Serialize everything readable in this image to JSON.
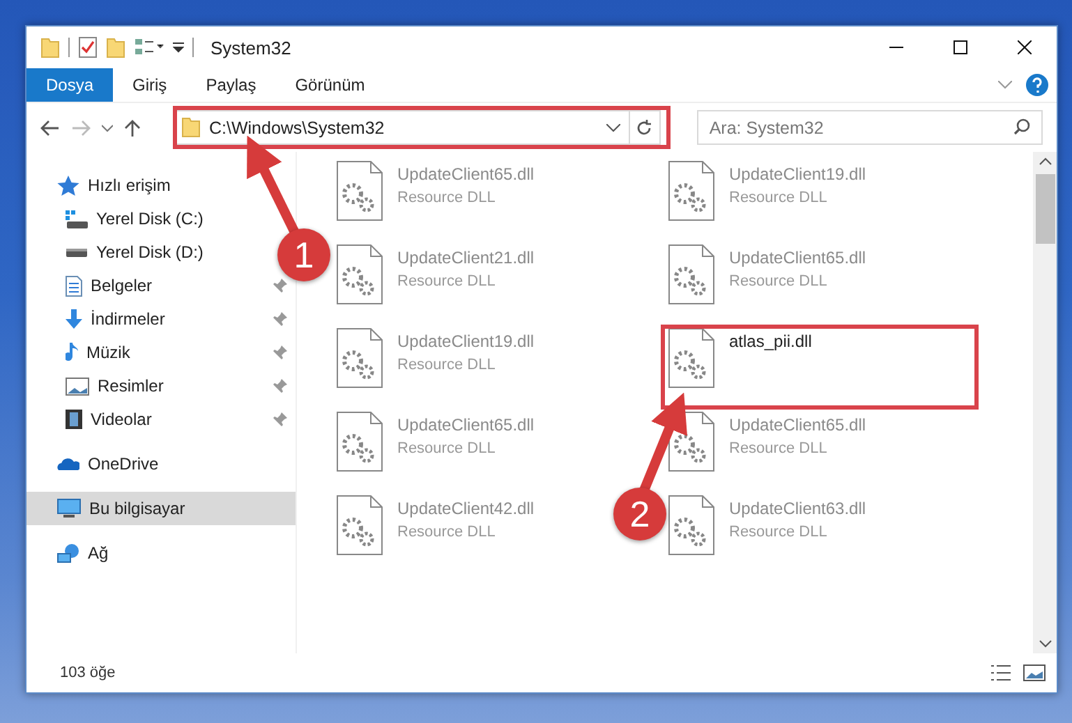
{
  "window": {
    "title": "System32"
  },
  "ribbon_tabs": [
    {
      "label": "Dosya",
      "selected": true
    },
    {
      "label": "Giriş",
      "selected": false
    },
    {
      "label": "Paylaş",
      "selected": false
    },
    {
      "label": "Görünüm",
      "selected": false
    }
  ],
  "address": {
    "path": "C:\\Windows\\System32"
  },
  "search": {
    "placeholder": "Ara: System32"
  },
  "sidebar": [
    {
      "label": "Hızlı erişim",
      "kind": "star",
      "selected": false,
      "children": [
        {
          "label": "Yerel Disk (C:)",
          "kind": "system-disk",
          "pinned": false
        },
        {
          "label": "Yerel Disk (D:)",
          "kind": "disk",
          "pinned": false
        },
        {
          "label": "Belgeler",
          "kind": "documents",
          "pinned": true
        },
        {
          "label": "İndirmeler",
          "kind": "download",
          "pinned": true
        },
        {
          "label": "Müzik",
          "kind": "music",
          "pinned": true
        },
        {
          "label": "Resimler",
          "kind": "pictures",
          "pinned": true
        },
        {
          "label": "Videolar",
          "kind": "videos",
          "pinned": true
        }
      ]
    },
    {
      "label": "OneDrive",
      "kind": "cloud",
      "selected": false
    },
    {
      "label": "Bu bilgisayar",
      "kind": "computer",
      "selected": true
    },
    {
      "label": "Ağ",
      "kind": "network",
      "selected": false
    }
  ],
  "files": [
    {
      "name": "UpdateClient65.dll",
      "type": "Resource DLL",
      "dimmed": true
    },
    {
      "name": "UpdateClient19.dll",
      "type": "Resource DLL",
      "dimmed": true
    },
    {
      "name": "UpdateClient21.dll",
      "type": "Resource DLL",
      "dimmed": true
    },
    {
      "name": "UpdateClient65.dll",
      "type": "Resource DLL",
      "dimmed": true
    },
    {
      "name": "UpdateClient19.dll",
      "type": "Resource DLL",
      "dimmed": true
    },
    {
      "name": "atlas_pii.dll",
      "dimmed": false
    },
    {
      "name": "UpdateClient65.dll",
      "type": "Resource DLL",
      "dimmed": true
    },
    {
      "name": "UpdateClient65.dll",
      "type": "Resource DLL",
      "dimmed": true
    },
    {
      "name": "UpdateClient42.dll",
      "type": "Resource DLL",
      "dimmed": true
    },
    {
      "name": "UpdateClient63.dll",
      "type": "Resource DLL",
      "dimmed": true
    }
  ],
  "status_bar": {
    "count": "103 öğe"
  },
  "annotations": [
    {
      "number": "1"
    },
    {
      "number": "2"
    }
  ]
}
